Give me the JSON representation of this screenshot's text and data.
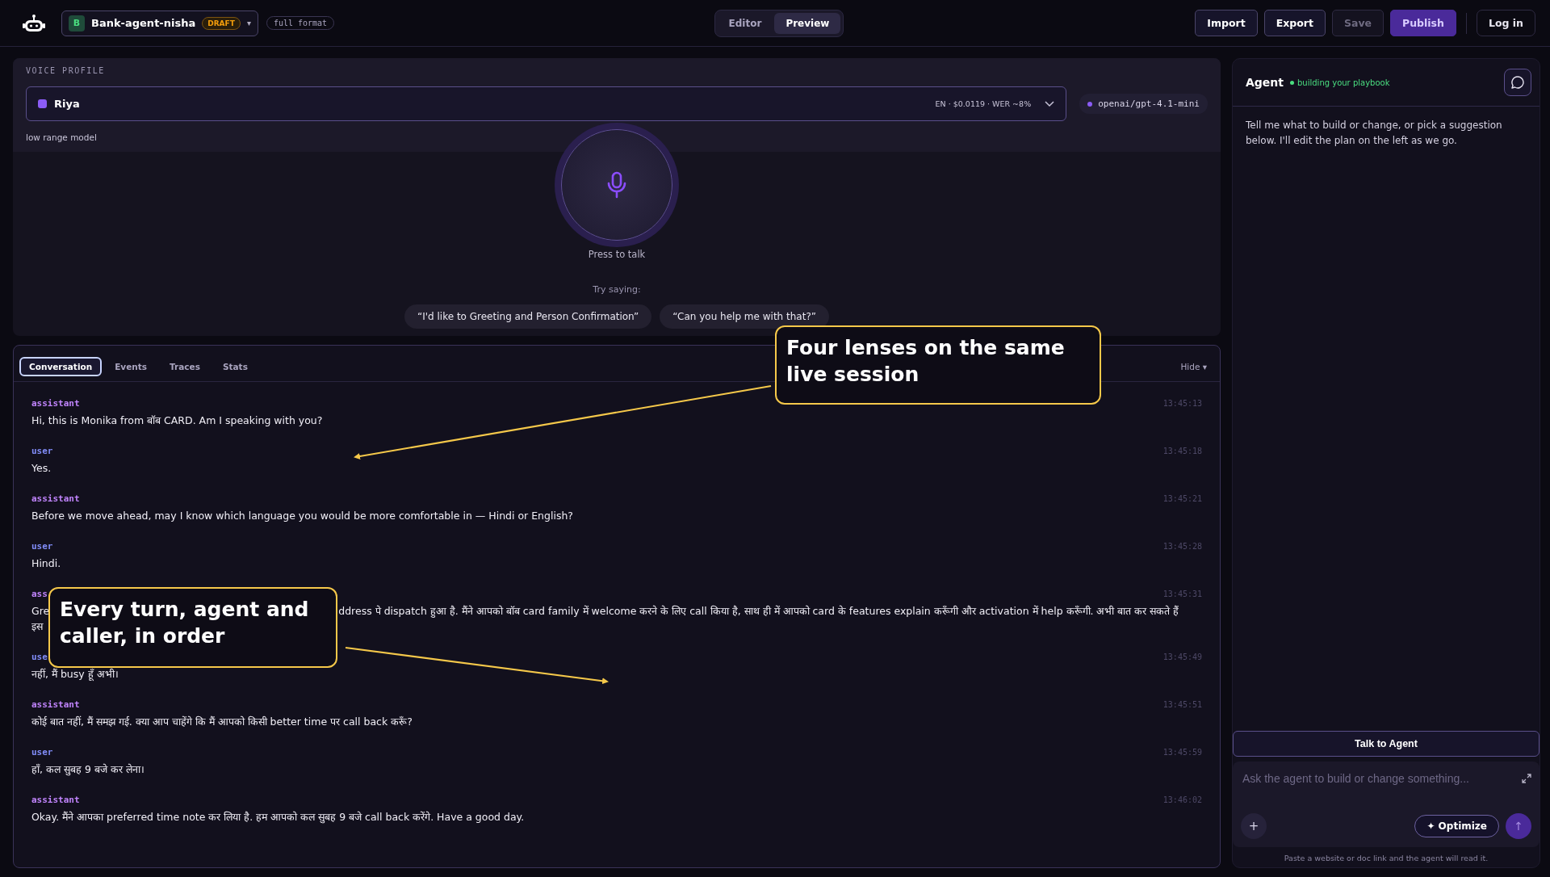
{
  "topbar": {
    "project": {
      "initial": "B",
      "name": "Bank-agent-nisha",
      "badge": "DRAFT",
      "caret": "▾"
    },
    "format": "full format",
    "modes": [
      {
        "label": "Editor",
        "selected": false
      },
      {
        "label": "Preview",
        "selected": true
      }
    ],
    "actions": [
      {
        "label": "Import",
        "kind": "outline",
        "disabled": false
      },
      {
        "label": "Export",
        "kind": "outline",
        "disabled": false
      },
      {
        "label": "Save",
        "kind": "outline",
        "disabled": true
      },
      {
        "label": "Publish",
        "kind": "primary",
        "disabled": false
      }
    ],
    "login": "Log in"
  },
  "voice_profile": {
    "heading": "VOICE PROFILE",
    "voice": {
      "name": "Riya",
      "meta": "EN · $0.0119 · WER ~8%"
    },
    "model": "openai/gpt-4.1-mini",
    "note": "low range model",
    "talk_label": "Press to talk",
    "try_label": "Try saying:",
    "suggestions": [
      "“I'd like to Greeting and Person Confirmation”",
      "“Can you help me with that?”"
    ]
  },
  "session": {
    "tabs": [
      {
        "label": "Conversation",
        "selected": true
      },
      {
        "label": "Events",
        "selected": false
      },
      {
        "label": "Traces",
        "selected": false
      },
      {
        "label": "Stats",
        "selected": false
      }
    ],
    "hide": "Hide ▾",
    "messages": [
      {
        "kind": "assistant",
        "role": "assistant",
        "time": "13:45:13",
        "text": "Hi, this is Monika from बॉब CARD. Am I speaking with you?"
      },
      {
        "kind": "user",
        "role": "user",
        "time": "13:45:18",
        "text": "Yes."
      },
      {
        "kind": "assistant",
        "role": "assistant",
        "time": "13:45:21",
        "text": "Before we move ahead, may I know which language you would be more comfortable in — Hindi or English?"
      },
      {
        "kind": "user",
        "role": "user",
        "time": "13:45:28",
        "text": "Hindi."
      },
      {
        "kind": "assistant",
        "role": "ass",
        "time": "13:45:31",
        "fragments": [
          "Gre",
          "ddress पे dispatch हुआ है. मैंने आपको बॉब card family में welcome करने के लिए call किया है, साथ ही में आपको card के features explain करूँगी और activation में help करूँगी. अभी बात कर सकते हैं",
          "इस"
        ]
      },
      {
        "kind": "user",
        "role": "use",
        "time": "13:45:49",
        "text": "नहीं, मैं busy हूँ अभी।"
      },
      {
        "kind": "assistant",
        "role": "assistant",
        "time": "13:45:51",
        "text": "कोई बात नहीं, मैं समझ गई. क्या आप चाहेंगे कि मैं आपको किसी better time पर call back करूँ?"
      },
      {
        "kind": "user",
        "role": "user",
        "time": "13:45:59",
        "text": "हाँ, कल सुबह 9 बजे कर लेना।"
      },
      {
        "kind": "assistant",
        "role": "assistant",
        "time": "13:46:02",
        "text": "Okay. मैंने आपका preferred time note कर लिया है. हम आपको कल सुबह 9 बजे call back करेंगे. Have a good day."
      }
    ]
  },
  "agent_panel": {
    "title": "Agent",
    "status": "building your playbook",
    "intro": "Tell me what to build or change, or pick a suggestion below. I'll edit the plan on the left as we go.",
    "talk_button": "Talk to Agent",
    "placeholder": "Ask the agent to build or change something...",
    "add": "+",
    "optimize": "✦ Optimize",
    "send": "↑",
    "footer": "Paste a website or doc link and the agent will read it."
  },
  "annotations": [
    {
      "text": "Four lenses on the same live session"
    },
    {
      "text": "Every turn, agent and caller, in order"
    }
  ]
}
